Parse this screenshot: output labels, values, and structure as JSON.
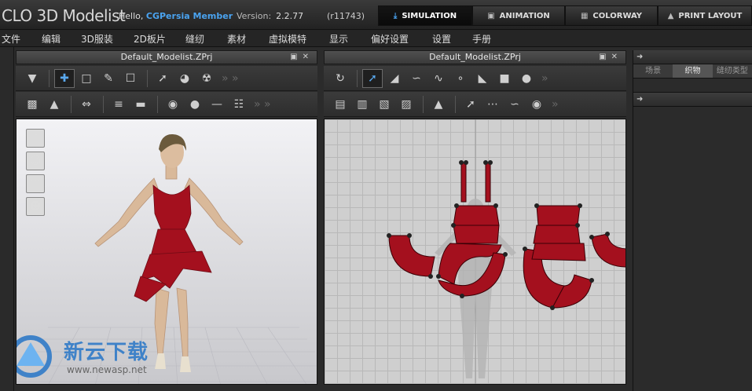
{
  "header": {
    "logo_text": "CLO 3D Modelist",
    "greeting": "Hello,",
    "username": "CGPersia Member",
    "version_label": "Version:",
    "version_number": "2.2.77",
    "build": "(r11743)"
  },
  "mode_tabs": [
    {
      "label": "SIMULATION",
      "icon": "chevron-down-icon",
      "active": true
    },
    {
      "label": "ANIMATION",
      "icon": "film-camera-icon",
      "active": false
    },
    {
      "label": "COLORWAY",
      "icon": "palette-icon",
      "active": false
    },
    {
      "label": "PRINT LAYOUT",
      "icon": "shirt-icon",
      "active": false
    }
  ],
  "menu": [
    "文件",
    "编辑",
    "3D服装",
    "2D板片",
    "缝纫",
    "素材",
    "虚拟模特",
    "显示",
    "偏好设置",
    "设置",
    "手册"
  ],
  "panel_3d": {
    "title": "Default_Modelist.ZPrj"
  },
  "panel_2d": {
    "title": "Default_Modelist.ZPrj"
  },
  "right_panel": {
    "tabs": [
      "场景",
      "织物",
      "缝纫类型"
    ],
    "active_tab": "织物"
  },
  "watermark": {
    "title": "新云下载",
    "url": "www.newasp.net"
  },
  "colors": {
    "accent": "#4aa3f0",
    "fabric": "#a4101e",
    "background": "#2b2b2b"
  }
}
